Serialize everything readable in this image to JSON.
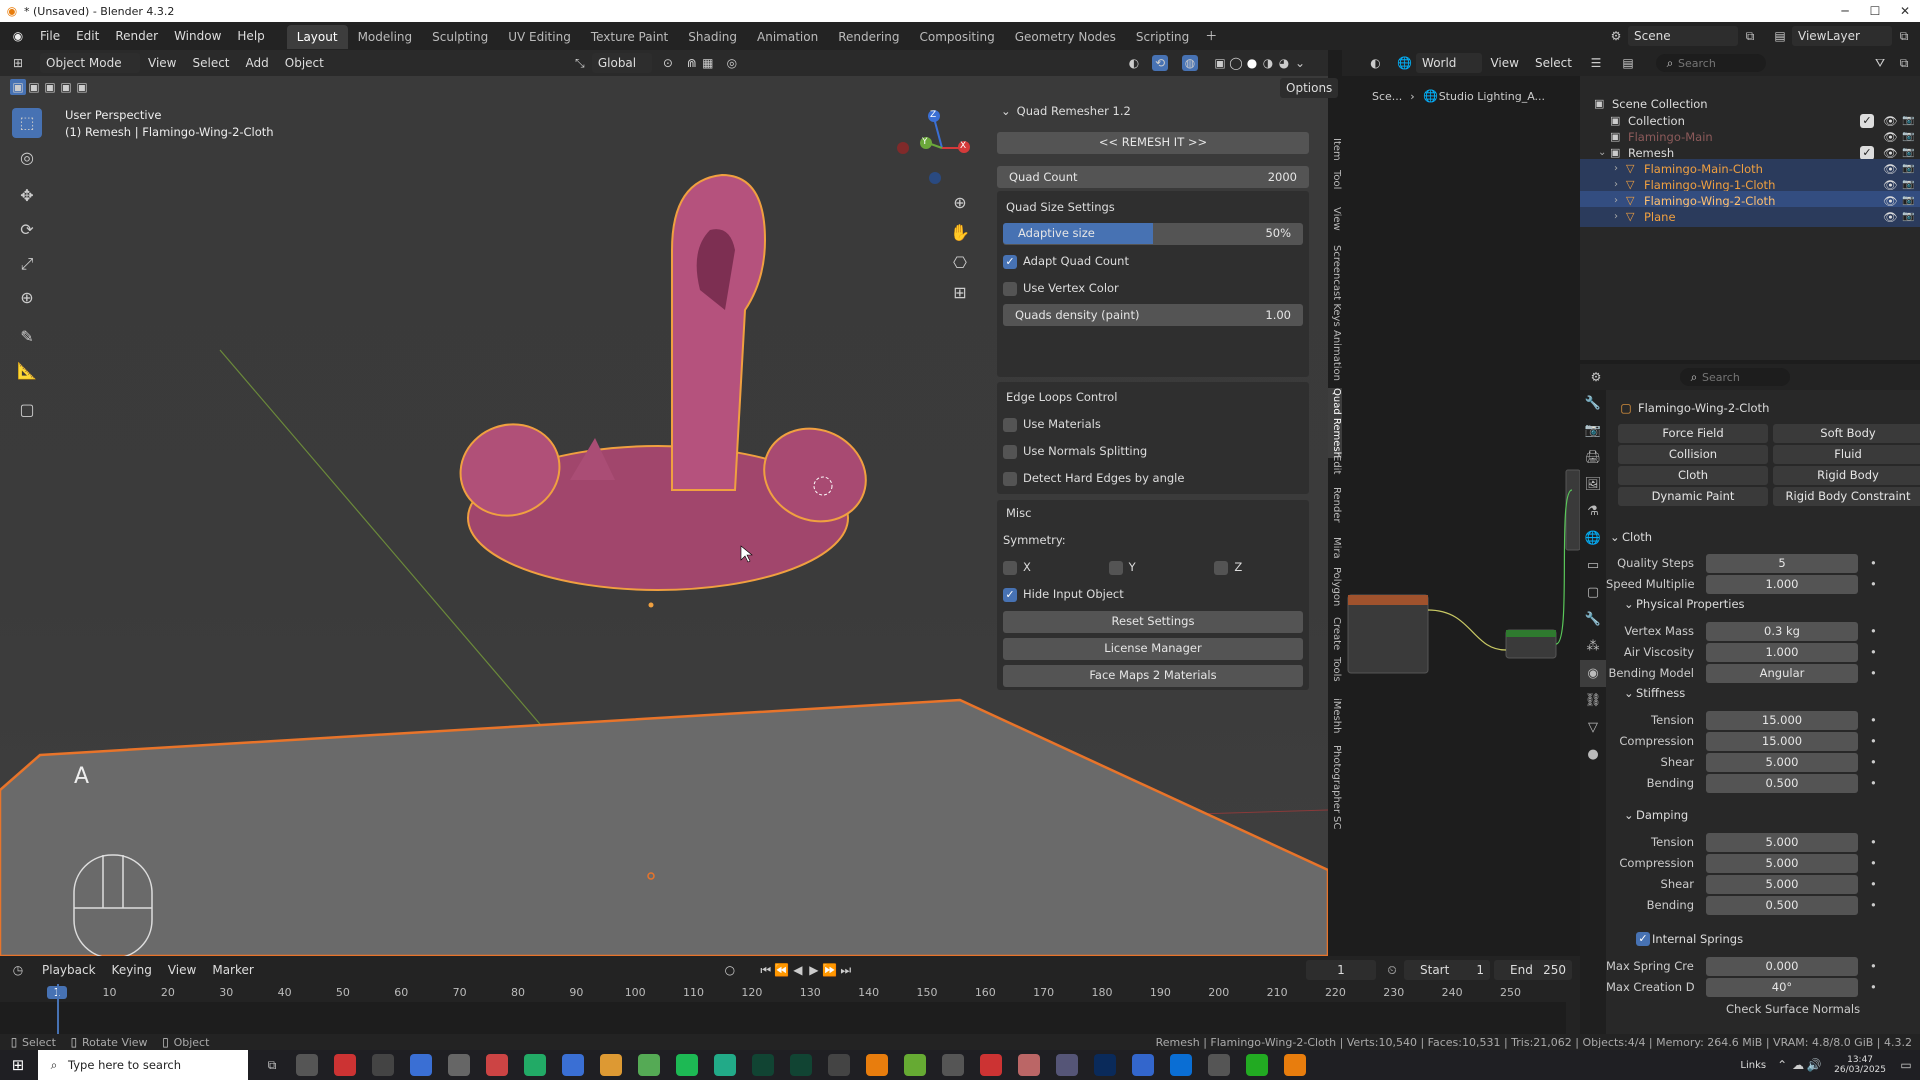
{
  "window": {
    "title": "* (Unsaved) - Blender 4.3.2"
  },
  "topbar": {
    "menus": [
      "File",
      "Edit",
      "Render",
      "Window",
      "Help"
    ],
    "workspaces": [
      "Layout",
      "Modeling",
      "Sculpting",
      "UV Editing",
      "Texture Paint",
      "Shading",
      "Animation",
      "Rendering",
      "Compositing",
      "Geometry Nodes",
      "Scripting"
    ],
    "active_workspace": "Layout",
    "scene": "Scene",
    "viewlayer": "ViewLayer"
  },
  "viewport": {
    "mode": "Object Mode",
    "menus": [
      "View",
      "Select",
      "Add",
      "Object"
    ],
    "orientation": "Global",
    "options": "Options",
    "overlay_line1": "User Perspective",
    "overlay_line2": "(1) Remesh | Flamingo-Wing-2-Cloth",
    "axis_x": "X",
    "axis_y": "Y",
    "axis_z": "Z",
    "key_hint": "A"
  },
  "npanel": {
    "title": "Quad Remesher 1.2",
    "remesh_button": "<< REMESH IT >>",
    "quad_count_label": "Quad Count",
    "quad_count_value": "2000",
    "size_section": "Quad Size Settings",
    "adaptive_label": "Adaptive size",
    "adaptive_value": "50%",
    "adaptive_fraction": 0.5,
    "adapt_quad_count": "Adapt Quad Count",
    "use_vertex_color": "Use Vertex Color",
    "density_label": "Quads density (paint)",
    "density_value": "1.00",
    "edge_section": "Edge Loops Control",
    "use_materials": "Use Materials",
    "use_normals": "Use Normals Splitting",
    "detect_hard": "Detect Hard Edges by angle",
    "misc_section": "Misc",
    "symmetry_label": "Symmetry:",
    "sym_x": "X",
    "sym_y": "Y",
    "sym_z": "Z",
    "hide_input": "Hide Input Object",
    "reset": "Reset Settings",
    "license": "License Manager",
    "facemaps": "Face Maps 2 Materials",
    "tabs": [
      "Item",
      "Tool",
      "View",
      "Screencast Keys",
      "Animation",
      "Quad Remesh",
      "Edit",
      "Render",
      "Mira",
      "Polygon",
      "Create",
      "Tools",
      "iMeshh",
      "Photographer",
      "SC"
    ]
  },
  "nodeheader": {
    "world": "World",
    "view": "View",
    "select": "Select",
    "crumb1": "Sce...",
    "crumb2": "Studio Lighting_A..."
  },
  "outliner": {
    "search_placeholder": "Search",
    "items": [
      {
        "label": "Scene Collection",
        "color": "#dddddd"
      },
      {
        "label": "Collection",
        "color": "#dddddd"
      },
      {
        "label": "Flamingo-Main",
        "color": "#8c5a5a"
      },
      {
        "label": "Remesh",
        "color": "#dddddd"
      },
      {
        "label": "Flamingo-Main-Cloth",
        "color": "#f0a040"
      },
      {
        "label": "Flamingo-Wing-1-Cloth",
        "color": "#f0a040"
      },
      {
        "label": "Flamingo-Wing-2-Cloth",
        "color": "#ffc070"
      },
      {
        "label": "Plane",
        "color": "#f0a040"
      }
    ]
  },
  "properties": {
    "search_placeholder": "Search",
    "object": "Flamingo-Wing-2-Cloth",
    "physics": [
      [
        "Force Field",
        "Soft Body"
      ],
      [
        "Collision",
        "Fluid"
      ],
      [
        "Cloth",
        "Rigid Body"
      ],
      [
        "Dynamic Paint",
        "Rigid Body Constraint"
      ]
    ],
    "cloth_header": "Cloth",
    "quality_label": "Quality Steps",
    "quality": "5",
    "speed_label": "Speed Multiplier",
    "speed": "1.000",
    "physical_header": "Physical Properties",
    "mass_label": "Vertex Mass",
    "mass": "0.3 kg",
    "air_label": "Air Viscosity",
    "air": "1.000",
    "bending_model_label": "Bending Model",
    "bending_model": "Angular",
    "stiffness_header": "Stiffness",
    "stiff": [
      [
        "Tension",
        "15.000"
      ],
      [
        "Compression",
        "15.000"
      ],
      [
        "Shear",
        "5.000"
      ],
      [
        "Bending",
        "0.500"
      ]
    ],
    "damping_header": "Damping",
    "damp": [
      [
        "Tension",
        "5.000"
      ],
      [
        "Compression",
        "5.000"
      ],
      [
        "Shear",
        "5.000"
      ],
      [
        "Bending",
        "0.500"
      ]
    ],
    "springs_header": "Internal Springs",
    "springs": [
      [
        "Max Spring Creati...",
        "0.000"
      ],
      [
        "Max Creation Dive...",
        "40°"
      ]
    ],
    "check_surface": "Check Surface Normals"
  },
  "timeline": {
    "menus": [
      "Playback",
      "Keying",
      "View",
      "Marker"
    ],
    "frame": "1",
    "start_label": "Start",
    "start": "1",
    "end_label": "End",
    "end": "250",
    "ticks": [
      "1",
      "10",
      "20",
      "30",
      "40",
      "50",
      "60",
      "70",
      "80",
      "90",
      "100",
      "110",
      "120",
      "130",
      "140",
      "150",
      "160",
      "170",
      "180",
      "190",
      "200",
      "210",
      "220",
      "230",
      "240",
      "250"
    ]
  },
  "status": {
    "select": "Select",
    "rotate": "Rotate View",
    "object": "Object",
    "info": "Remesh | Flamingo-Wing-2-Cloth | Verts:10,540 | Faces:10,531 | Tris:21,062 | Objects:4/4 | Memory: 264.6 MiB | VRAM: 4.8/8.0 GiB | 4.3.2"
  },
  "taskbar": {
    "search": "Type here to search",
    "links": "Links",
    "time": "13:47",
    "date": "26/03/2025"
  }
}
